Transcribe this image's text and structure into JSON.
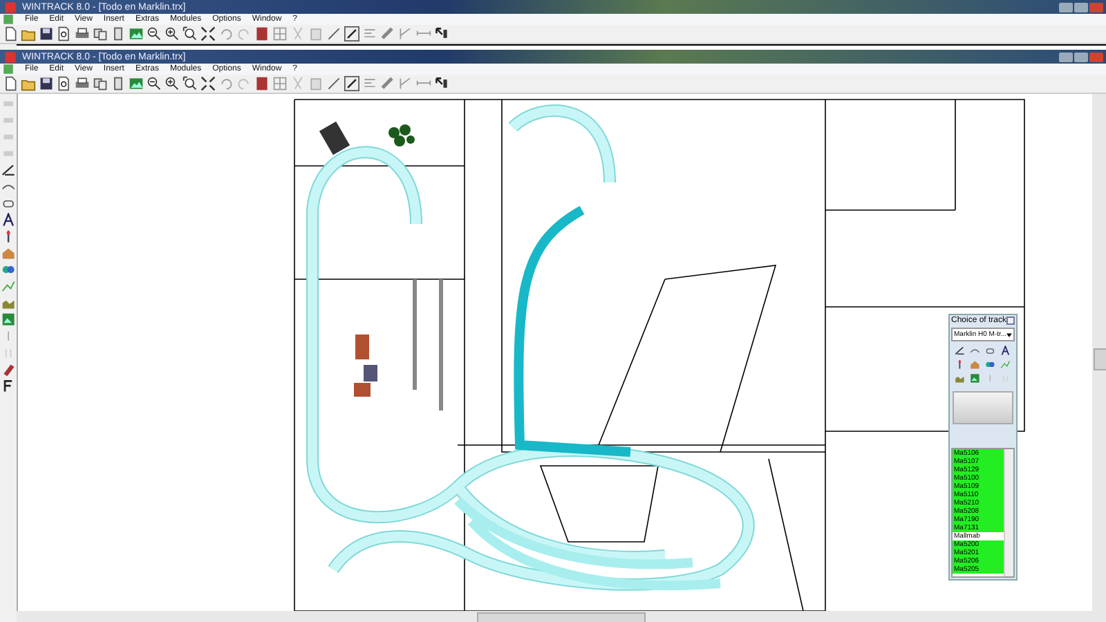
{
  "windows": [
    {
      "title": "WINTRACK 8.0 - [Todo en Marklin.trx]",
      "menu": [
        "File",
        "Edit",
        "View",
        "Insert",
        "Extras",
        "Modules",
        "Options",
        "Window",
        "?"
      ]
    },
    {
      "title": "WINTRACK 8.0 - [Todo en Marklin.trx]",
      "menu": [
        "File",
        "Edit",
        "View",
        "Insert",
        "Extras",
        "Modules",
        "Options",
        "Window",
        "?"
      ]
    }
  ],
  "track_panel": {
    "title": "Choice of track",
    "catalog": "Marklin H0 M-tr...",
    "items": [
      {
        "label": "Ma5106",
        "highlighted": true
      },
      {
        "label": "Ma5107",
        "highlighted": true
      },
      {
        "label": "Ma5129",
        "highlighted": true
      },
      {
        "label": "Ma5100",
        "highlighted": true
      },
      {
        "label": "Ma5109",
        "highlighted": true
      },
      {
        "label": "Ma5110",
        "highlighted": true
      },
      {
        "label": "Ma5210",
        "highlighted": true
      },
      {
        "label": "Ma5208",
        "highlighted": true
      },
      {
        "label": "Ma7190",
        "highlighted": true
      },
      {
        "label": "Ma7131",
        "highlighted": true
      },
      {
        "label": "Mallmab",
        "highlighted": false
      },
      {
        "label": "Ma5200",
        "highlighted": true
      },
      {
        "label": "Ma5201",
        "highlighted": true
      },
      {
        "label": "Ma5206",
        "highlighted": true
      },
      {
        "label": "Ma5205",
        "highlighted": true
      }
    ]
  }
}
